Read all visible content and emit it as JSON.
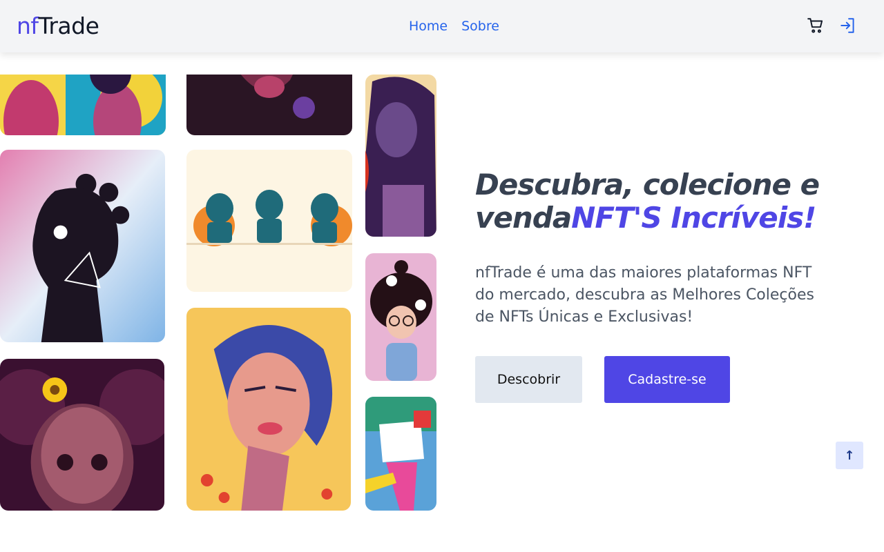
{
  "brand": {
    "prefix": "nf",
    "suffix": "Trade"
  },
  "nav": {
    "links": [
      "Home",
      "Sobre"
    ]
  },
  "icons": {
    "cart": "shopping-cart-icon",
    "login": "login-icon",
    "scroll_top": "arrow-up-icon"
  },
  "hero": {
    "headline_plain": "Descubra, colecione e venda",
    "headline_highlight": "NFT'S Incríveis!",
    "description": "nfTrade é uma das maiores plataformas NFT do mercado, descubra as Melhores Coleções de NFTs Únicas e Exclusivas!",
    "buttons": {
      "discover": "Descobrir",
      "signup": "Cadastre-se"
    }
  },
  "scroll_top_label": "↑",
  "colors": {
    "accent": "#4f46e5",
    "link": "#2563eb",
    "heading": "#374151",
    "navbar_bg": "#f3f4f6",
    "secondary_button": "#e2e8f0"
  }
}
